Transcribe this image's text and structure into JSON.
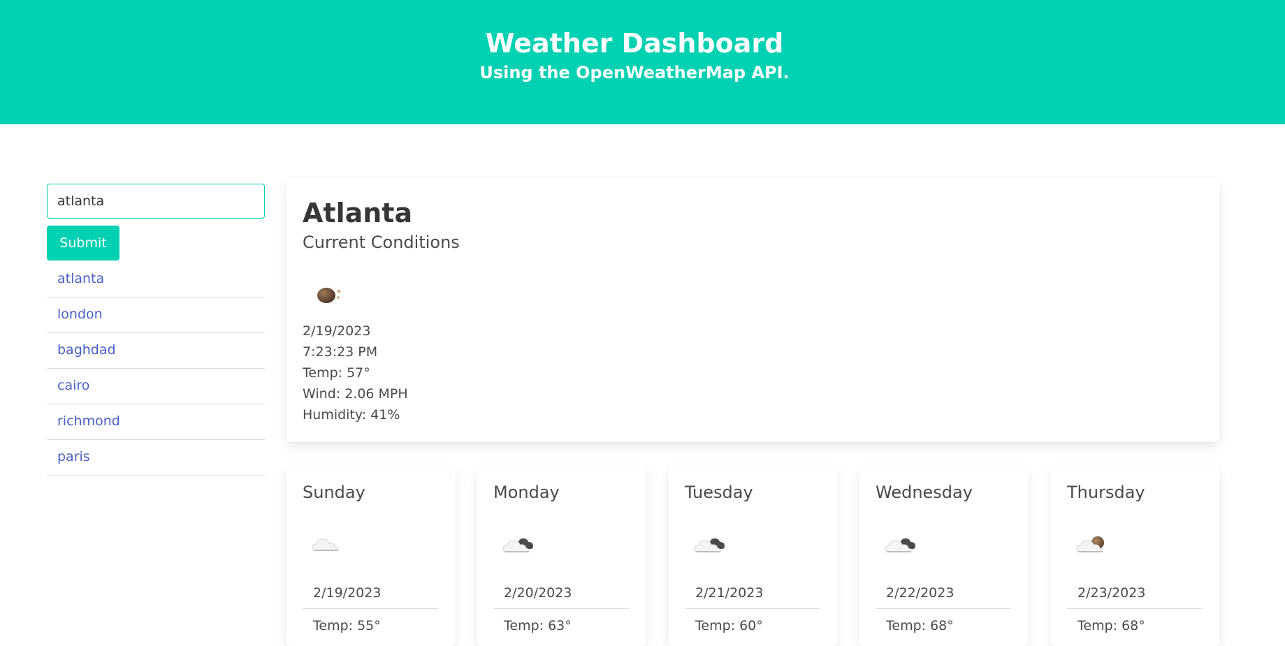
{
  "header": {
    "title": "Weather Dashboard",
    "subtitle": "Using the OpenWeatherMap API."
  },
  "search": {
    "value": "atlanta",
    "submit_label": "Submit"
  },
  "history": [
    "atlanta",
    "london",
    "baghdad",
    "cairo",
    "richmond",
    "paris"
  ],
  "current": {
    "city": "Atlanta",
    "heading": "Current Conditions",
    "icon": "night-moon-icon",
    "date": "2/19/2023",
    "time": "7:23:23 PM",
    "temp": "Temp: 57°",
    "wind": "Wind: 2.06 MPH",
    "humidity": "Humidity: 41%"
  },
  "forecast": [
    {
      "day": "Sunday",
      "icon": "cloud-icon",
      "date": "2/19/2023",
      "temp": "Temp: 55°"
    },
    {
      "day": "Monday",
      "icon": "dark-clouds-icon",
      "date": "2/20/2023",
      "temp": "Temp: 63°"
    },
    {
      "day": "Tuesday",
      "icon": "dark-clouds-icon",
      "date": "2/21/2023",
      "temp": "Temp: 60°"
    },
    {
      "day": "Wednesday",
      "icon": "dark-clouds-icon",
      "date": "2/22/2023",
      "temp": "Temp: 68°"
    },
    {
      "day": "Thursday",
      "icon": "cloud-moon-icon",
      "date": "2/23/2023",
      "temp": "Temp: 68°"
    }
  ],
  "colors": {
    "primary": "#00d1b2",
    "link": "#485fc7",
    "text": "#4a4a4a"
  }
}
